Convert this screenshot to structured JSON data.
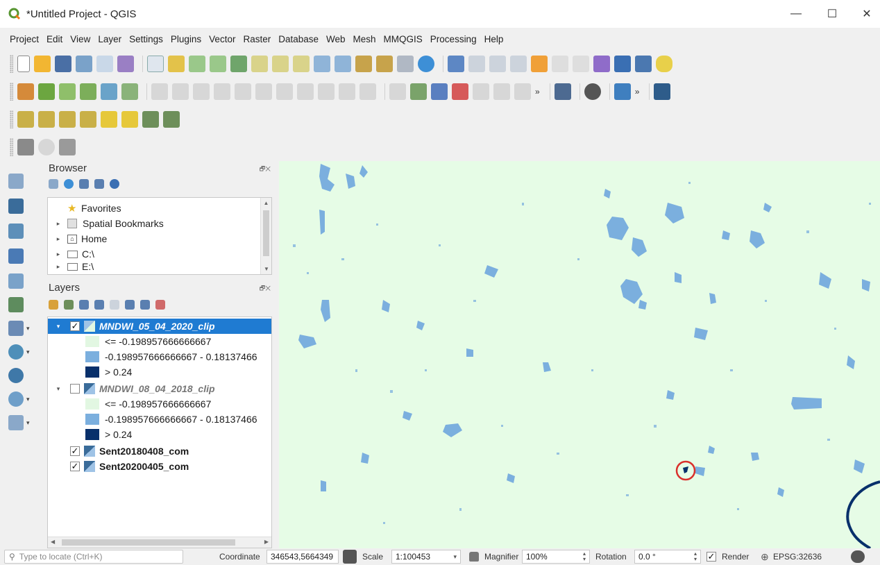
{
  "window": {
    "title": "*Untitled Project - QGIS",
    "minimize": "—",
    "maximize": "☐",
    "close": "✕"
  },
  "menu": [
    "Project",
    "Edit",
    "View",
    "Layer",
    "Settings",
    "Plugins",
    "Vector",
    "Raster",
    "Database",
    "Web",
    "Mesh",
    "MMQGIS",
    "Processing",
    "Help"
  ],
  "toolbar_more": "»",
  "browser": {
    "title": "Browser",
    "items": [
      {
        "label": "Favorites",
        "icon": "star-icon"
      },
      {
        "label": "Spatial Bookmarks",
        "icon": "bookmark-icon"
      },
      {
        "label": "Home",
        "icon": "home-icon"
      },
      {
        "label": "C:\\",
        "icon": "folder-icon"
      },
      {
        "label": "E:\\",
        "icon": "folder-icon"
      }
    ]
  },
  "layers": {
    "title": "Layers",
    "items": [
      {
        "name": "MNDWI_05_04_2020_clip",
        "checked": true,
        "selected": true,
        "legend": [
          {
            "label": "<= -0.198957666666667",
            "color": "#e2f7e2"
          },
          {
            "label": "-0.198957666666667 - 0.18137466",
            "color": "#7bafde"
          },
          {
            "label": "> 0.24",
            "color": "#08306b"
          }
        ]
      },
      {
        "name": "MNDWI_08_04_2018_clip",
        "checked": false,
        "selected": false,
        "legend": [
          {
            "label": "<= -0.198957666666667",
            "color": "#e2f7e2"
          },
          {
            "label": "-0.198957666666667 - 0.18137466",
            "color": "#7bafde"
          },
          {
            "label": "> 0.24",
            "color": "#08306b"
          }
        ]
      },
      {
        "name": "Sent20180408_com",
        "checked": true,
        "selected": false
      },
      {
        "name": "Sent20200405_com",
        "checked": true,
        "selected": false
      }
    ]
  },
  "status": {
    "locate_placeholder": "Type to locate (Ctrl+K)",
    "coordinate_label": "Coordinate",
    "coordinate_value": "346543,5664349",
    "scale_label": "Scale",
    "scale_value": "1:100453",
    "magnifier_label": "Magnifier",
    "magnifier_value": "100%",
    "rotation_label": "Rotation",
    "rotation_value": "0.0 °",
    "render_label": "Render",
    "render_checked": true,
    "crs": "EPSG:32636"
  },
  "colors": {
    "map_background": "#e6fce6",
    "water_light": "#7bafde",
    "water_dark": "#08306b",
    "selection": "#1f7bd2",
    "highlight_circle": "#d9302c"
  }
}
